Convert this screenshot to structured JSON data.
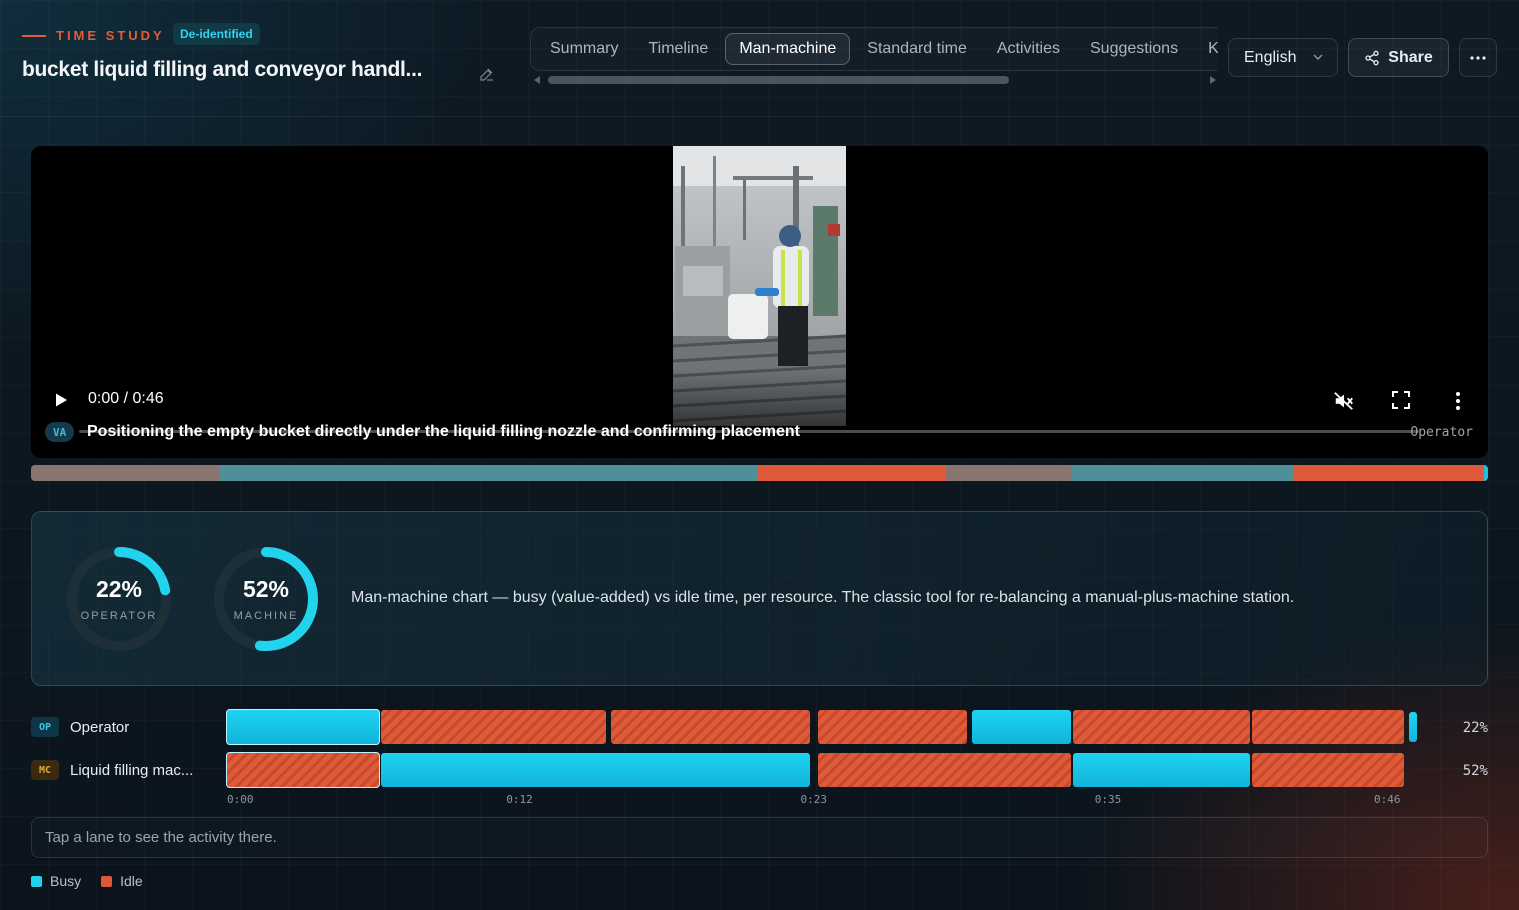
{
  "header": {
    "eyebrow": "TIME STUDY",
    "badge": "De-identified",
    "title": "bucket liquid filling and conveyor handl...",
    "tabs": [
      {
        "label": "Summary"
      },
      {
        "label": "Timeline"
      },
      {
        "label": "Man-machine",
        "active": true
      },
      {
        "label": "Standard time"
      },
      {
        "label": "Activities"
      },
      {
        "label": "Suggestions"
      },
      {
        "label": "K"
      }
    ],
    "language": "English",
    "share_label": "Share"
  },
  "video": {
    "time": "0:00 / 0:46",
    "chip": "VA",
    "caption": "Positioning the empty bucket directly under the liquid filling nozzle and confirming placement",
    "role": "Operator",
    "segments": [
      {
        "kind": "nva",
        "fraction": 0.129
      },
      {
        "kind": "va",
        "fraction": 0.369
      },
      {
        "kind": "idle",
        "fraction": 0.13
      },
      {
        "kind": "nva",
        "fraction": 0.086
      },
      {
        "kind": "va",
        "fraction": 0.152
      },
      {
        "kind": "idle",
        "fraction": 0.131
      },
      {
        "kind": "va",
        "fraction": 0.003
      }
    ]
  },
  "summary": {
    "operator": {
      "pct_label": "22%",
      "caption": "OPERATOR",
      "value": 0.22
    },
    "machine": {
      "pct_label": "52%",
      "caption": "MACHINE",
      "value": 0.52
    },
    "description": "Man-machine chart — busy (value-added) vs idle time, per resource. The classic tool for re-balancing a manual-plus-machine station."
  },
  "lanes": [
    {
      "chip": "OP",
      "name": "Operator",
      "pct": "22%",
      "blocks": [
        {
          "state": "busy",
          "start": 0.0,
          "end": 6.0,
          "selected": true
        },
        {
          "state": "idle",
          "start": 6.1,
          "end": 15.0
        },
        {
          "state": "idle",
          "start": 15.2,
          "end": 23.1
        },
        {
          "state": "idle",
          "start": 23.4,
          "end": 29.3
        },
        {
          "state": "busy",
          "start": 29.5,
          "end": 33.4
        },
        {
          "state": "idle",
          "start": 33.5,
          "end": 40.5
        },
        {
          "state": "idle",
          "start": 40.6,
          "end": 46.6
        },
        {
          "state": "busy",
          "start": 46.8,
          "end": 47.1
        }
      ]
    },
    {
      "chip": "MC",
      "name": "Liquid filling mac...",
      "pct": "52%",
      "blocks": [
        {
          "state": "idle",
          "start": 0.0,
          "end": 6.0,
          "selected": true
        },
        {
          "state": "busy",
          "start": 6.1,
          "end": 23.1
        },
        {
          "state": "idle",
          "start": 23.4,
          "end": 33.4
        },
        {
          "state": "busy",
          "start": 33.5,
          "end": 40.5
        },
        {
          "state": "idle",
          "start": 40.6,
          "end": 46.6
        }
      ]
    }
  ],
  "axis": {
    "duration": 46.6,
    "ticks": [
      {
        "label": "0:00",
        "t": 0
      },
      {
        "label": "0:12",
        "t": 11.65
      },
      {
        "label": "0:23",
        "t": 23.3
      },
      {
        "label": "0:35",
        "t": 34.95
      },
      {
        "label": "0:46",
        "t": 46.6
      }
    ]
  },
  "hint": "Tap a lane to see the activity there.",
  "legend": [
    {
      "label": "Busy",
      "color": "#22d3ee"
    },
    {
      "label": "Idle",
      "color": "#e0583a"
    }
  ],
  "colors": {
    "busy": "#1fd3f2",
    "idle": "#df5a38",
    "va_segment": "#4e8f98",
    "nva_segment": "#8a7470",
    "accent": "#e85a35"
  }
}
